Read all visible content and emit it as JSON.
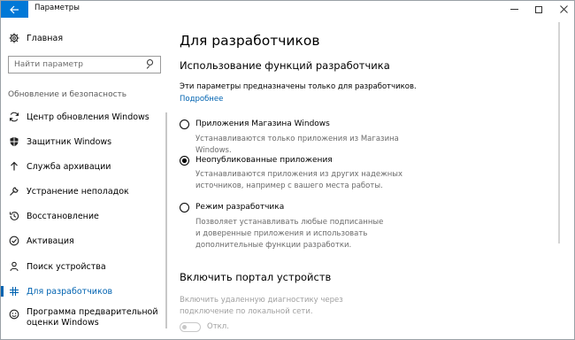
{
  "titlebar": {
    "title": "Параметры",
    "back_icon": "back-arrow-icon"
  },
  "sidebar": {
    "home_label": "Главная",
    "search_placeholder": "Найти параметр",
    "section_label": "Обновление и безопасность",
    "items": [
      {
        "label": "Центр обновления Windows",
        "icon": "sync-icon"
      },
      {
        "label": "Защитник Windows",
        "icon": "shield-icon"
      },
      {
        "label": "Служба архивации",
        "icon": "upload-icon"
      },
      {
        "label": "Устранение неполадок",
        "icon": "wrench-icon"
      },
      {
        "label": "Восстановление",
        "icon": "history-icon"
      },
      {
        "label": "Активация",
        "icon": "check-circle-icon"
      },
      {
        "label": "Поиск устройства",
        "icon": "person-icon"
      },
      {
        "label": "Для разработчиков",
        "icon": "developer-icon",
        "active": true
      },
      {
        "label": "Программа предварительной оценки Windows",
        "icon": "smiley-icon"
      }
    ]
  },
  "main": {
    "page_title": "Для разработчиков",
    "section_title": "Использование функций разработчика",
    "description": "Эти параметры предназначены только для разработчиков.",
    "more_link": "Подробнее",
    "options": [
      {
        "label": "Приложения Магазина Windows",
        "desc": "Устанавливаются только приложения из Магазина Windows.",
        "checked": false
      },
      {
        "label": "Неопубликованные приложения",
        "desc": "Устанавливаются приложения из других надежных источников, например с вашего места работы.",
        "checked": true
      },
      {
        "label": "Режим разработчика",
        "desc": "Позволяет устанавливать любые подписанные и доверенные приложения и использовать дополнительные функции разработки.",
        "checked": false
      }
    ],
    "portal_title": "Включить портал устройств",
    "portal_desc": "Включить удаленную диагностику через подключение по локальной сети.",
    "toggle_state": "Откл."
  },
  "colors": {
    "accent": "#0078d7",
    "link": "#0063b1",
    "disabled_text": "#a0a0a0"
  }
}
